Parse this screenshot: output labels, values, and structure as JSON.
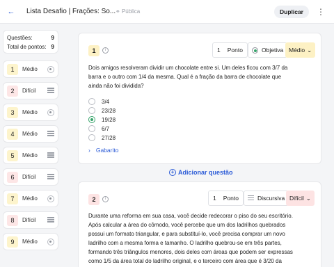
{
  "header": {
    "back_icon": "arrow-left-icon",
    "title": "Lista Desafio | Frações: So...",
    "visibility": "Pública",
    "duplicate_label": "Duplicar",
    "menu_icon": "kebab-icon"
  },
  "summary": {
    "questions_label": "Questões:",
    "questions_value": "9",
    "points_label": "Total de pontos:",
    "points_value": "9"
  },
  "sidebar": {
    "items": [
      {
        "num": "1",
        "level": "Médio",
        "type": "objective"
      },
      {
        "num": "2",
        "level": "Difícil",
        "type": "discursive"
      },
      {
        "num": "3",
        "level": "Médio",
        "type": "objective"
      },
      {
        "num": "4",
        "level": "Médio",
        "type": "discursive"
      },
      {
        "num": "5",
        "level": "Médio",
        "type": "discursive"
      },
      {
        "num": "6",
        "level": "Difícil",
        "type": "discursive"
      },
      {
        "num": "7",
        "level": "Médio",
        "type": "objective"
      },
      {
        "num": "8",
        "level": "Difícil",
        "type": "discursive"
      },
      {
        "num": "9",
        "level": "Médio",
        "type": "objective"
      }
    ]
  },
  "question1": {
    "num": "1",
    "points_value": "1",
    "points_label": "Ponto",
    "type_label": "Objetiva",
    "difficulty": "Médio",
    "text": "Dois amigos resolveram dividir um chocolate entre si. Um deles ficou com 3/7 da barra e o outro com 1/4 da mesma. Qual é a fração da barra de chocolate que ainda não foi dividida?",
    "options": [
      "3/4",
      "23/28",
      "19/28",
      "6/7",
      "27/28"
    ],
    "selected": "19/28",
    "answer_label": "Gabarito"
  },
  "add_question_label": "Adicionar questão",
  "question2": {
    "num": "2",
    "points_value": "1",
    "points_label": "Ponto",
    "type_label": "Discursiva",
    "difficulty": "Difícil",
    "text": "Durante uma reforma em sua casa, você decide redecorar o piso do seu escritório. Após calcular a área do cômodo, você percebe que um dos ladrilhos quebrados possui um formato triangular, e para substituí-lo, você precisa comprar um novo ladrilho com a mesma forma e tamanho. O ladrilho quebrou-se em três partes, formando três triângulos menores, dois deles com áreas que podem ser expressas como 1/5 da área total do ladrilho original, e o terceiro com área que é 3/20 da área total do"
  },
  "colors": {
    "accent": "#2b5bd7",
    "medio": "#fdf1c4",
    "dificil": "#fde3e3",
    "selected": "#36a46a"
  }
}
